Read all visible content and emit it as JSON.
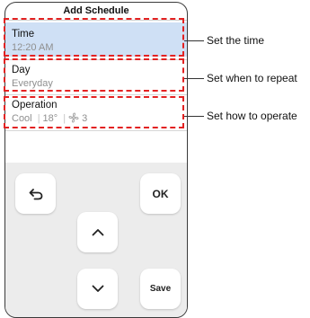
{
  "screen": {
    "title": "Add Schedule",
    "rows": [
      {
        "label": "Time",
        "value": "12:20 AM"
      },
      {
        "label": "Day",
        "value": "Everyday"
      },
      {
        "label": "Operation",
        "mode": "Cool",
        "temp": "18°",
        "fan": "3"
      }
    ]
  },
  "keypad": {
    "ok_label": "OK",
    "save_label": "Save"
  },
  "callouts": [
    "Set the time",
    "Set when to repeat",
    "Set how to operate"
  ],
  "colors": {
    "selected_row": "#cfe0f5",
    "highlight_dash": "#e32222"
  }
}
